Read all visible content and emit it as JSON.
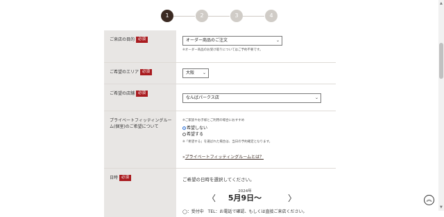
{
  "steps": [
    "1",
    "2",
    "3",
    "4"
  ],
  "form": {
    "purpose": {
      "label": "ご来店の目的",
      "required": "必須",
      "value": "オーダー商品のご注文",
      "note": "※オーダー商品のお受け取りについてはご予約不要です。"
    },
    "area": {
      "label": "ご希望のエリア",
      "required": "必須",
      "value": "大阪"
    },
    "store": {
      "label": "ご希望の店舗",
      "required": "必須",
      "value": "なんばパークス店"
    },
    "fitting": {
      "label": "プライベートフィッティングルーム(個室)のご希望について",
      "note_top": "※ご家族やお子様とご利用の場合におすすめ",
      "options": [
        "希望しない",
        "希望する"
      ],
      "note_bottom": "※「希望する」を選ばれた場合は、当日の予約確定となります。",
      "link_prefix": "»",
      "link_text": "プライベートフィッティングルームとは？"
    },
    "date": {
      "label": "日時",
      "required": "必須",
      "instruction": "ご希望の日時を選択してください。",
      "year": "2024年",
      "day": "5月9日〜",
      "prev": "〈",
      "next": "〉",
      "legend": "◯：受付中　TEL：お電話で確認、もしくは直接ご来店ください。"
    }
  },
  "icons": {
    "scroll_up": "triangle-up",
    "scroll_down": "triangle-down",
    "back_to_top": "double-chevron-up"
  },
  "colors": {
    "active_step": "#3b2a22",
    "inactive_step": "#d0ccc7",
    "required_badge": "#a91b1f",
    "label_bg": "#e8e6e4"
  }
}
